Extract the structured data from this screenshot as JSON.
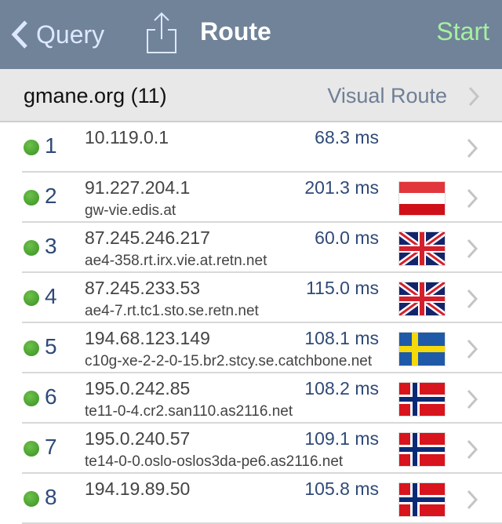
{
  "navbar": {
    "back_label": "Query",
    "title": "Route",
    "start_label": "Start"
  },
  "header": {
    "host": "gmane.org (11)",
    "visual_route_label": "Visual Route"
  },
  "hops": [
    {
      "num": "1",
      "ip": "10.119.0.1",
      "host": "",
      "ms": "68.3 ms",
      "flag": "none",
      "status": "green"
    },
    {
      "num": "2",
      "ip": "91.227.204.1",
      "host": "gw-vie.edis.at",
      "ms": "201.3 ms",
      "flag": "austria",
      "status": "green"
    },
    {
      "num": "3",
      "ip": "87.245.246.217",
      "host": "ae4-358.rt.irx.vie.at.retn.net",
      "ms": "60.0 ms",
      "flag": "uk",
      "status": "green"
    },
    {
      "num": "4",
      "ip": "87.245.233.53",
      "host": "ae4-7.rt.tc1.sto.se.retn.net",
      "ms": "115.0 ms",
      "flag": "uk",
      "status": "green"
    },
    {
      "num": "5",
      "ip": "194.68.123.149",
      "host": "c10g-xe-2-2-0-15.br2.stcy.se.catchbone.net",
      "ms": "108.1 ms",
      "flag": "sweden",
      "status": "green"
    },
    {
      "num": "6",
      "ip": "195.0.242.85",
      "host": "te11-0-4.cr2.san110.as2116.net",
      "ms": "108.2 ms",
      "flag": "norway",
      "status": "green"
    },
    {
      "num": "7",
      "ip": "195.0.240.57",
      "host": "te14-0-0.oslo-oslos3da-pe6.as2116.net",
      "ms": "109.1 ms",
      "flag": "norway",
      "status": "green"
    },
    {
      "num": "8",
      "ip": "194.19.89.50",
      "host": "",
      "ms": "105.8 ms",
      "flag": "norway",
      "status": "green"
    }
  ],
  "colors": {
    "navbar": "#708399",
    "start": "#a6f0a0",
    "status_green": "#4aa530",
    "ms_text": "#2f4a78"
  }
}
